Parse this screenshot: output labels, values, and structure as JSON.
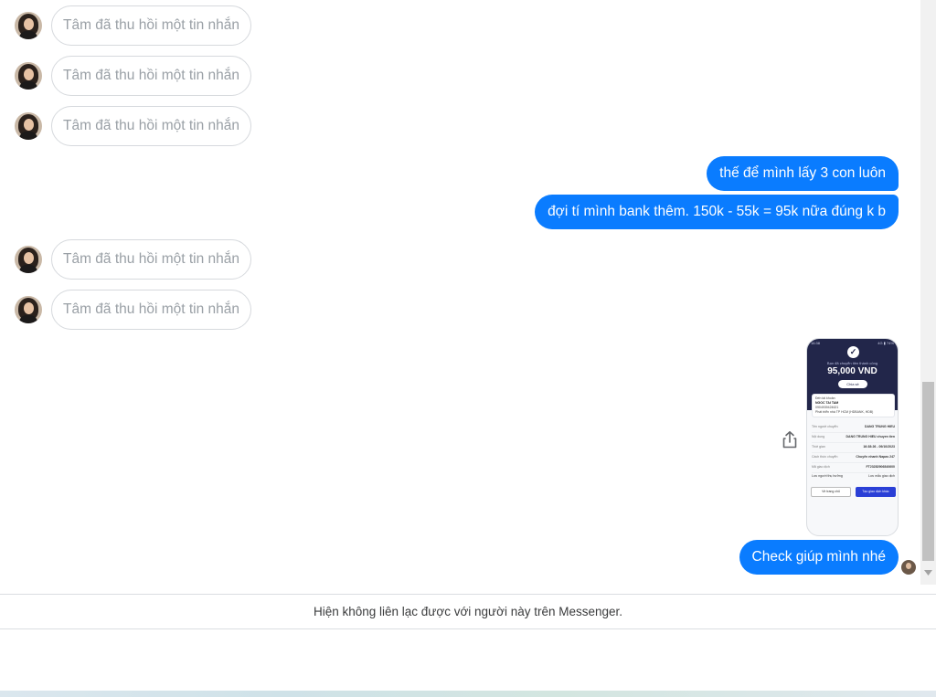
{
  "conversation": {
    "recalled_text": "Tâm đã thu hồi một tin nhắn",
    "messages_before": [
      {
        "type": "recalled",
        "text": "Tâm đã thu hồi một tin nhắn"
      },
      {
        "type": "recalled",
        "text": "Tâm đã thu hồi một tin nhắn"
      },
      {
        "type": "recalled",
        "text": "Tâm đã thu hồi một tin nhắn"
      }
    ],
    "outgoing_1": "thế để mình lấy 3 con luôn",
    "outgoing_2": "đợi tí mình bank thêm. 150k - 55k = 95k nữa đúng k b",
    "messages_after": [
      {
        "type": "recalled",
        "text": "Tâm đã thu hồi một tin nhắn"
      },
      {
        "type": "recalled",
        "text": "Tâm đã thu hồi một tin nhắn"
      }
    ],
    "outgoing_3": "Check giúp mình nhé"
  },
  "receipt_image": {
    "status_left": "16:38",
    "status_right": "4G ▮ 74%",
    "subtitle": "Bạn đã chuyển tiền thành công",
    "amount": "95,000 VND",
    "share_label": "Chia sẻ",
    "recipient_label": "Đến tài khoản",
    "recipient_name": "NGOC TAI TAM",
    "recipient_account": "0904939424621",
    "recipient_bank": "Phát triển nhà TP HCM (HDBANK, HDB)",
    "rows": [
      {
        "label": "Tên người chuyển",
        "value": "DANG TRUNG HIEU"
      },
      {
        "label": "Nội dung",
        "value": "DANG TRUNG HIEU chuyen tien"
      },
      {
        "label": "Thời gian",
        "value": "16:38:26 - 09/10/2023"
      },
      {
        "label": "Cách thức chuyển",
        "value": "Chuyển nhanh Napas 247"
      },
      {
        "label": "Mã giao dịch",
        "value": "FT23282906840600"
      }
    ],
    "link_left": "Lưu người thụ hưởng",
    "link_right": "Lưu mẫu giao dịch",
    "button_left": "Về trang chủ",
    "button_right": "Tạo giao dịch khác"
  },
  "notice": "Hiện không liên lạc được với người này trên Messenger.",
  "colors": {
    "outgoing_bubble": "#0a7cff",
    "recalled_border": "#d6d9dd",
    "recalled_text": "#9aa0a6",
    "receipt_header": "#22264a"
  },
  "icons": {
    "share": "share-icon",
    "scroll_down": "scroll-down-arrow-icon"
  }
}
